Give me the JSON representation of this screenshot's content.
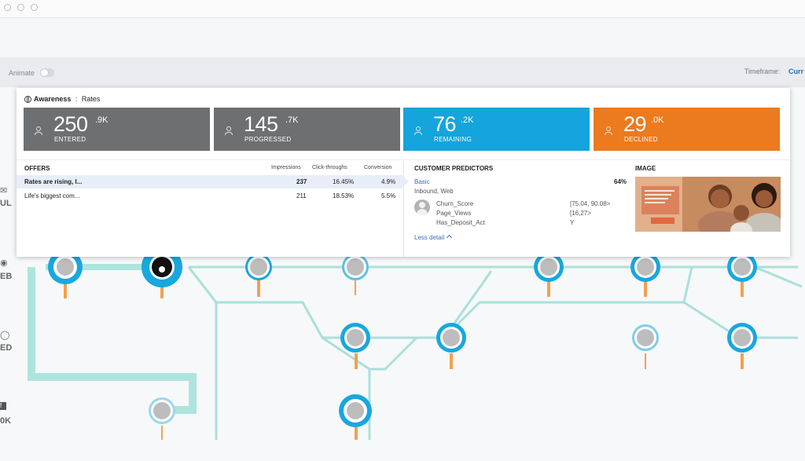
{
  "toolbar": {
    "animate_label": "Animate",
    "timeframe_label": "Timeframe:",
    "timeframe_value": "Curr"
  },
  "sidebar": {
    "labels": [
      "UL",
      "EB",
      "ED",
      "0K"
    ]
  },
  "breadcrumb": {
    "stage": "Awareness",
    "separator": ":",
    "group": "Rates"
  },
  "metrics": [
    {
      "value": "250",
      "suffix": ".9K",
      "label": "ENTERED",
      "color": "#6d6f70"
    },
    {
      "value": "145",
      "suffix": ".7K",
      "label": "PROGRESSED",
      "color": "#6d6f70"
    },
    {
      "value": "76",
      "suffix": ".2K",
      "label": "REMAINING",
      "color": "#15a4dc"
    },
    {
      "value": "29",
      "suffix": ".0K",
      "label": "DECLINED",
      "color": "#ec7a1e"
    }
  ],
  "offers": {
    "title": "OFFERS",
    "columns": [
      "Impressions",
      "Click-throughs",
      "Conversion"
    ],
    "rows": [
      {
        "name": "Rates are rising, I...",
        "impressions": "237",
        "clickthroughs": "16.45%",
        "conversion": "4.9%"
      },
      {
        "name": "Life's biggest com...",
        "impressions": "211",
        "clickthroughs": "18.53%",
        "conversion": "5.5%"
      }
    ]
  },
  "predictors": {
    "title": "CUSTOMER PREDICTORS",
    "model": "Basic",
    "channel": "Inbound, Web",
    "score": "64%",
    "names": [
      "Churn_Score",
      "Page_Views",
      "Has_Deposit_Act"
    ],
    "values": [
      "[75.04, 90.08>",
      "[16,27>",
      "Y"
    ],
    "less_detail": "Less detail"
  },
  "image": {
    "title": "IMAGE"
  },
  "colors": {
    "accent_blue": "#15a4dc",
    "accent_orange": "#ec7a1e",
    "tile_gray": "#6d6f70",
    "flow_line": "#a9e0dc"
  }
}
